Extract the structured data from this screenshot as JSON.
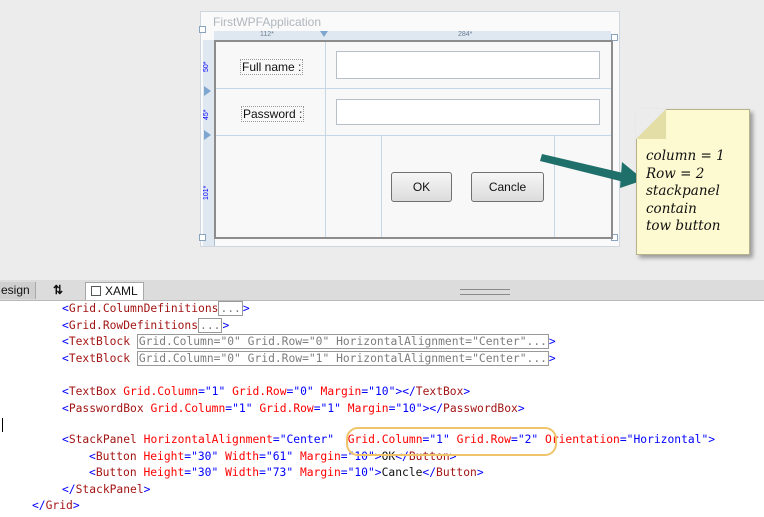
{
  "designer": {
    "window_title": "FirstWPFApplication",
    "ruler": {
      "col0": "112*",
      "col1": "284*",
      "row0": "50*",
      "row1": "45*",
      "row2": "101*"
    },
    "labels": {
      "full_name": "Full name :",
      "password": "Password :"
    },
    "buttons": {
      "ok": "OK",
      "cancel": "Cancle"
    }
  },
  "note": {
    "text": "column = 1\nRow = 2\nstackpanel\ncontain\ntow button"
  },
  "tabs": {
    "design": "esign",
    "swap": "⇅",
    "xaml": "XAML"
  },
  "code": {
    "l1": {
      "open": "<",
      "tag": "Grid.ColumnDefinitions",
      "ellipsis": "...",
      "close": ">"
    },
    "l2": {
      "open": "<",
      "tag": "Grid.RowDefinitions",
      "ellipsis": "...",
      "close": ">"
    },
    "l3": {
      "open": "<",
      "tag": "TextBlock",
      "collapsed": "Grid.Column=\"0\" Grid.Row=\"0\" HorizontalAlignment=\"Center\"...",
      "close": ">"
    },
    "l4": {
      "open": "<",
      "tag": "TextBlock",
      "collapsed": "Grid.Column=\"0\" Grid.Row=\"1\" HorizontalAlignment=\"Center\"...",
      "close": ">"
    },
    "l5": {
      "open": "<",
      "tag": "TextBox",
      "a1": "Grid.Column",
      "v1": "\"1\"",
      "a2": "Grid.Row",
      "v2": "\"0\"",
      "a3": "Margin",
      "v3": "\"10\"",
      "mid": "></",
      "endtag": "TextBox",
      "close": ">"
    },
    "l6": {
      "open": "<",
      "tag": "PasswordBox",
      "a1": "Grid.Column",
      "v1": "\"1\"",
      "a2": "Grid.Row",
      "v2": "\"1\"",
      "a3": "Margin",
      "v3": "\"10\"",
      "mid": "></",
      "endtag": "PasswordBox",
      "close": ">"
    },
    "l7": {
      "open": "<",
      "tag": "StackPanel",
      "a1": "HorizontalAlignment",
      "v1": "\"Center\"",
      "a2": "Grid.Column",
      "v2": "\"1\"",
      "a3": "Grid.Row",
      "v3": "\"2\"",
      "a4": "Orientation",
      "v4": "\"Horizontal\"",
      "close": ">"
    },
    "l8": {
      "open": "<",
      "tag": "Button",
      "a1": "Height",
      "v1": "\"30\"",
      "a2": "Width",
      "v2": "\"61\"",
      "a3": "Margin",
      "v3": "\"10\"",
      "content": "OK",
      "endopen": "</",
      "endtag": "Button",
      "close": ">"
    },
    "l9": {
      "open": "<",
      "tag": "Button",
      "a1": "Height",
      "v1": "\"30\"",
      "a2": "Width",
      "v2": "\"73\"",
      "a3": "Margin",
      "v3": "\"10\"",
      "content": "Cancle",
      "endopen": "</",
      "endtag": "Button",
      "close": ">"
    },
    "l10": {
      "open": "</",
      "tag": "StackPanel",
      "close": ">"
    },
    "l11": {
      "open": "</",
      "tag": "Grid",
      "close": ">"
    }
  }
}
